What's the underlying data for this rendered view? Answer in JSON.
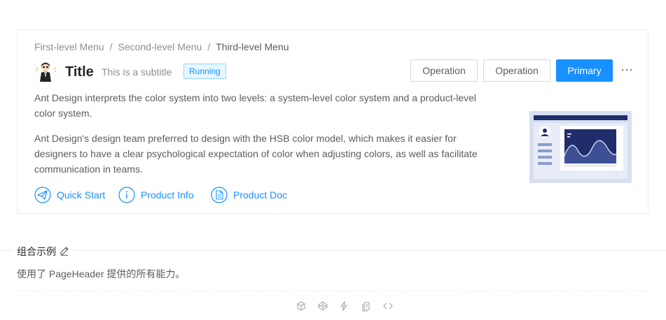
{
  "breadcrumb": {
    "items": [
      "First-level Menu",
      "Second-level Menu",
      "Third-level Menu"
    ],
    "separator": "/"
  },
  "header": {
    "title": "Title",
    "subtitle": "This is a subtitle",
    "tag": "Running",
    "buttons": {
      "operation_1": "Operation",
      "operation_2": "Operation",
      "primary": "Primary"
    },
    "more": "···"
  },
  "content": {
    "paragraph_1": "Ant Design interprets the color system into two levels: a system-level color system and a product-level color system.",
    "paragraph_2": "Ant Design's design team preferred to design with the HSB color model, which makes it easier for designers to have a clear psychological expectation of color when adjusting colors, as well as facilitate communication in teams.",
    "links": [
      {
        "label": "Quick Start",
        "icon": "send-icon"
      },
      {
        "label": "Product Info",
        "icon": "info-icon"
      },
      {
        "label": "Product Doc",
        "icon": "doc-icon"
      }
    ]
  },
  "section": {
    "title": "组合示例",
    "description": "使用了 PageHeader 提供的所有能力。"
  },
  "colors": {
    "accent": "#1890ff",
    "tag_bg": "#e6f7ff",
    "tag_border": "#91d5ff",
    "illustration": "#1f2d6b"
  },
  "toolbar_icons": [
    "codesandbox-icon",
    "codepen-icon",
    "riddle-icon",
    "copy-icon",
    "code-expand-icon"
  ]
}
